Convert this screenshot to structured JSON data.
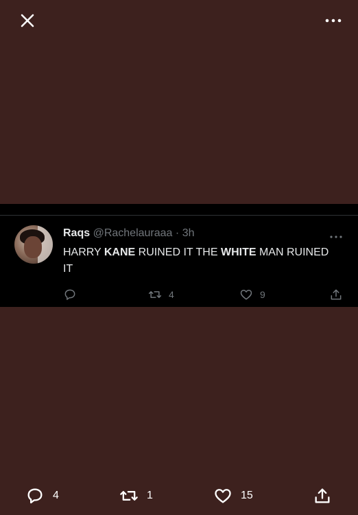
{
  "topbar": {
    "close_icon": "close-icon",
    "more_icon": "more-horizontal-icon"
  },
  "tweet": {
    "display_name": "Raqs",
    "handle": "@Rachelauraaa",
    "separator": "·",
    "time": "3h",
    "text_parts": [
      "HARRY ",
      "KANE",
      " RUINED IT THE ",
      "WHITE",
      " MAN RUINED IT"
    ],
    "reply_count": "",
    "retweet_count": "4",
    "like_count": "9"
  },
  "bottom_bar": {
    "reply_count": "4",
    "retweet_count": "1",
    "like_count": "15"
  },
  "colors": {
    "background": "#3d211e",
    "card": "#000000",
    "muted": "#71767b"
  }
}
